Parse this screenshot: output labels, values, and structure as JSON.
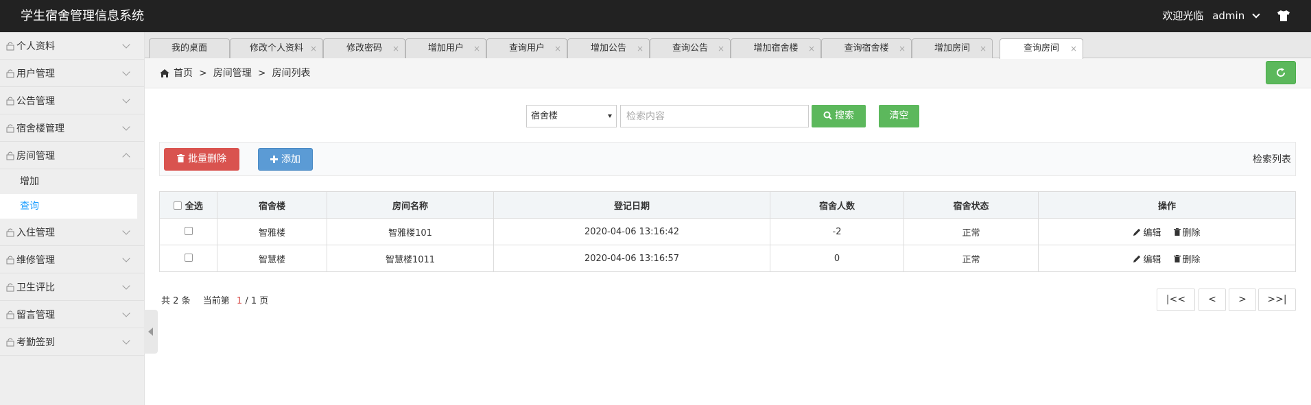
{
  "header": {
    "title": "学生宿舍管理信息系统",
    "welcome": "欢迎光临",
    "username": "admin"
  },
  "sidebar": {
    "items": [
      {
        "label": "个人资料"
      },
      {
        "label": "用户管理"
      },
      {
        "label": "公告管理"
      },
      {
        "label": "宿舍楼管理"
      },
      {
        "label": "房间管理"
      },
      {
        "label": "入住管理"
      },
      {
        "label": "维修管理"
      },
      {
        "label": "卫生评比"
      },
      {
        "label": "留言管理"
      },
      {
        "label": "考勤签到"
      }
    ],
    "sub_items": [
      {
        "label": "增加"
      },
      {
        "label": "查询"
      }
    ]
  },
  "tabs": [
    {
      "label": "我的桌面"
    },
    {
      "label": "修改个人资料"
    },
    {
      "label": "修改密码"
    },
    {
      "label": "增加用户"
    },
    {
      "label": "查询用户"
    },
    {
      "label": "增加公告"
    },
    {
      "label": "查询公告"
    },
    {
      "label": "增加宿舍楼"
    },
    {
      "label": "查询宿舍楼"
    },
    {
      "label": "增加房间"
    },
    {
      "label": "查询房间"
    }
  ],
  "tab_close": "×",
  "breadcrumb": {
    "home": "首页",
    "sep": ">",
    "level1": "房间管理",
    "level2": "房间列表"
  },
  "search": {
    "select_value": "宿舍楼",
    "placeholder": "检索内容",
    "search_label": "搜索",
    "clear_label": "清空"
  },
  "actions": {
    "batch_delete": "批量删除",
    "add": "添加",
    "list_title": "检索列表"
  },
  "table": {
    "headers": [
      "全选",
      "宿舍楼",
      "房间名称",
      "登记日期",
      "宿舍人数",
      "宿舍状态",
      "操作"
    ],
    "rows": [
      {
        "building": "智雅楼",
        "room": "智雅楼101",
        "date": "2020-04-06 13:16:42",
        "count": "-2",
        "status": "正常"
      },
      {
        "building": "智慧楼",
        "room": "智慧楼1011",
        "date": "2020-04-06 13:16:57",
        "count": "0",
        "status": "正常"
      }
    ],
    "edit_label": "编辑",
    "delete_label": "删除"
  },
  "pagination": {
    "total_prefix": "共",
    "total": "2",
    "total_suffix": "条",
    "current_prefix": "当前第",
    "current": "1",
    "slash": "/",
    "pages": "1",
    "pages_suffix": "页",
    "first": "|<<",
    "prev": "<",
    "next": ">",
    "last": ">>|"
  },
  "colors": {
    "header_bg": "#222222",
    "accent_blue": "#1e9fff",
    "green": "#5cb85c",
    "red": "#d9534f",
    "blue_btn": "#5b9bd5"
  }
}
